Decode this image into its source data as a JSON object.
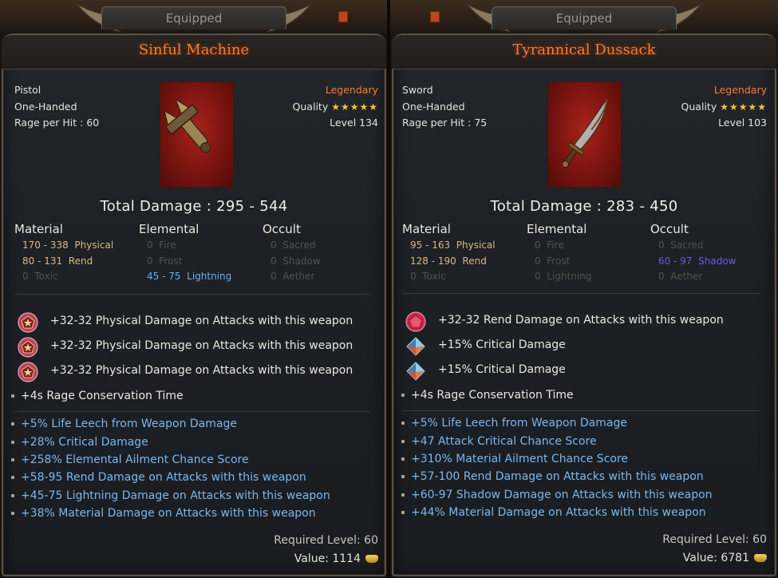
{
  "panels": [
    {
      "equipped_label": "Equipped",
      "name": "Sinful Machine",
      "type": "Pistol",
      "handed": "One-Handed",
      "rage_per_hit": "Rage per Hit : 60",
      "rarity": "Legendary",
      "quality_label": "Quality",
      "quality_stars": "★★★★★",
      "level": "Level 134",
      "total_damage": "Total Damage : 295 - 544",
      "damage_headers": [
        "Material",
        "Elemental",
        "Occult"
      ],
      "material": [
        {
          "value": "170 - 338",
          "type": "Physical"
        },
        {
          "value": "80 - 131",
          "type": "Rend"
        },
        {
          "value": "0",
          "type": "Toxic"
        }
      ],
      "elemental": [
        {
          "value": "0",
          "type": "Fire"
        },
        {
          "value": "0",
          "type": "Frost"
        },
        {
          "value": "45 - 75",
          "type": "Lightning"
        }
      ],
      "occult": [
        {
          "value": "0",
          "type": "Sacred"
        },
        {
          "value": "0",
          "type": "Shadow"
        },
        {
          "value": "0",
          "type": "Aether"
        }
      ],
      "gem_affixes": [
        {
          "gem": "pentagon-gem-icon",
          "text": "+32-32 Physical Damage on Attacks with this weapon"
        },
        {
          "gem": "pentagon-gem-icon",
          "text": "+32-32 Physical Damage on Attacks with this weapon"
        },
        {
          "gem": "pentagon-gem-icon",
          "text": "+32-32 Physical Damage on Attacks with this weapon"
        }
      ],
      "implicit": "+4s Rage Conservation Time",
      "mods": [
        "+5% Life Leech from Weapon Damage",
        "+28% Critical Damage",
        "+258% Elemental Ailment Chance Score",
        "+58-95 Rend Damage on Attacks with this weapon",
        "+45-75 Lightning Damage on Attacks with this weapon",
        "+38% Material Damage on Attacks with this weapon"
      ],
      "required_level": "Required Level: 60",
      "value": "Value: 1114"
    },
    {
      "equipped_label": "Equipped",
      "name": "Tyrannical Dussack",
      "type": "Sword",
      "handed": "One-Handed",
      "rage_per_hit": "Rage per Hit : 75",
      "rarity": "Legendary",
      "quality_label": "Quality",
      "quality_stars": "★★★★★",
      "level": "Level 103",
      "total_damage": "Total Damage : 283 - 450",
      "damage_headers": [
        "Material",
        "Elemental",
        "Occult"
      ],
      "material": [
        {
          "value": "95 - 163",
          "type": "Physical"
        },
        {
          "value": "128 - 190",
          "type": "Rend"
        },
        {
          "value": "0",
          "type": "Toxic"
        }
      ],
      "elemental": [
        {
          "value": "0",
          "type": "Fire"
        },
        {
          "value": "0",
          "type": "Frost"
        },
        {
          "value": "0",
          "type": "Lightning"
        }
      ],
      "occult": [
        {
          "value": "0",
          "type": "Sacred"
        },
        {
          "value": "60 - 97",
          "type": "Shadow"
        },
        {
          "value": "0",
          "type": "Aether"
        }
      ],
      "gem_affixes": [
        {
          "gem": "pentagon-gem-icon",
          "text": "+32-32 Rend Damage on Attacks with this weapon"
        },
        {
          "gem": "diamond-gem-icon",
          "text": "+15% Critical Damage"
        },
        {
          "gem": "diamond-gem-icon",
          "text": "+15% Critical Damage"
        }
      ],
      "implicit": "+4s Rage Conservation Time",
      "mods": [
        "+5% Life Leech from Weapon Damage",
        "+47 Attack Critical Chance Score",
        "+310% Material Ailment Chance Score",
        "+57-100 Rend Damage on Attacks with this weapon",
        "+60-97 Shadow Damage on Attacks with this weapon",
        "+44% Material Damage on Attacks with this weapon"
      ],
      "required_level": "Required Level: 60",
      "value": "Value: 6781"
    }
  ],
  "colors": {
    "legendary": "#ff7a2a",
    "mod_blue": "#78b8f2",
    "lightning": "#62b3f0",
    "shadow": "#6a5dd8",
    "dim": "#55524e",
    "stars": "#f3c43a"
  }
}
